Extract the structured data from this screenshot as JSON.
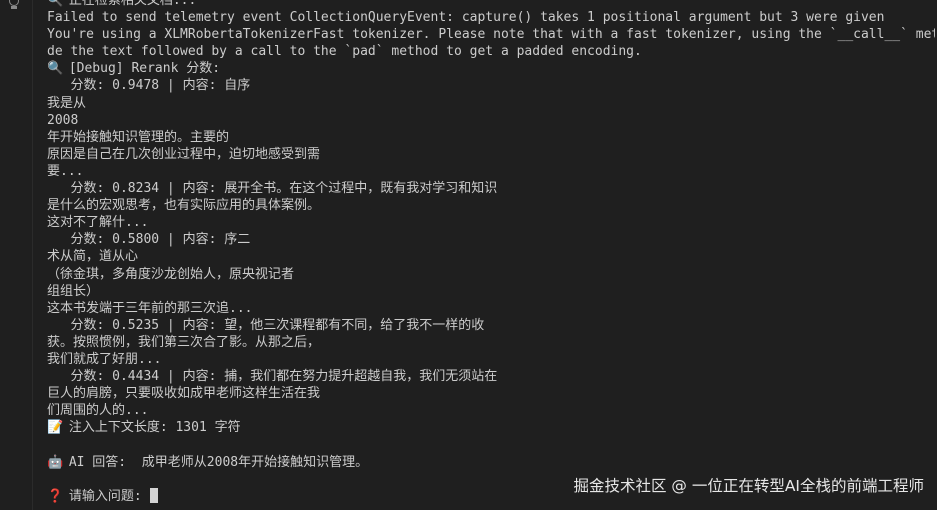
{
  "terminal": {
    "lines": [
      {
        "icon": "🔍",
        "text": "正在检索相关文档..."
      },
      {
        "icon": "",
        "text": "Failed to send telemetry event CollectionQueryEvent: capture() takes 1 positional argument but 3 were given"
      },
      {
        "icon": "",
        "text": "You're using a XLMRobertaTokenizerFast tokenizer. Please note that with a fast tokenizer, using the `__call__` method is faster"
      },
      {
        "icon": "",
        "text": "de the text followed by a call to the `pad` method to get a padded encoding."
      },
      {
        "icon": "🔍",
        "text": "[Debug] Rerank 分数:"
      },
      {
        "icon": "",
        "text": "   分数: 0.9478 | 内容: 自序"
      },
      {
        "icon": "",
        "text": "我是从"
      },
      {
        "icon": "",
        "text": "2008"
      },
      {
        "icon": "",
        "text": "年开始接触知识管理的。主要的"
      },
      {
        "icon": "",
        "text": "原因是自己在几次创业过程中，迫切地感受到需"
      },
      {
        "icon": "",
        "text": "要..."
      },
      {
        "icon": "",
        "text": "   分数: 0.8234 | 内容: 展开全书。在这个过程中，既有我对学习和知识"
      },
      {
        "icon": "",
        "text": "是什么的宏观思考，也有实际应用的具体案例。"
      },
      {
        "icon": "",
        "text": "这对不了解什..."
      },
      {
        "icon": "",
        "text": "   分数: 0.5800 | 内容: 序二"
      },
      {
        "icon": "",
        "text": "术从简，道从心"
      },
      {
        "icon": "",
        "text": "（徐金琪，多角度沙龙创始人，原央视记者"
      },
      {
        "icon": "",
        "text": "组组长）"
      },
      {
        "icon": "",
        "text": "这本书发端于三年前的那三次追..."
      },
      {
        "icon": "",
        "text": "   分数: 0.5235 | 内容: 望，他三次课程都有不同，给了我不一样的收"
      },
      {
        "icon": "",
        "text": "获。按照惯例，我们第三次合了影。从那之后，"
      },
      {
        "icon": "",
        "text": "我们就成了好朋..."
      },
      {
        "icon": "",
        "text": "   分数: 0.4434 | 内容: 捕，我们都在努力提升超越自我，我们无须站在"
      },
      {
        "icon": "",
        "text": "巨人的肩膀，只要吸收如成甲老师这样生活在我"
      },
      {
        "icon": "",
        "text": "们周围的人的..."
      },
      {
        "icon": "📝",
        "text": "注入上下文长度: 1301 字符"
      },
      {
        "icon": "",
        "text": ""
      },
      {
        "icon": "🤖",
        "text": "AI 回答:  成甲老师从2008年开始接触知识管理。"
      },
      {
        "icon": "",
        "text": ""
      }
    ],
    "prompt": {
      "icon": "❓",
      "text": "请输入问题: "
    }
  },
  "watermark": "掘金技术社区 @ 一位正在转型AI全栈的前端工程师",
  "icons": {
    "gutter": "lightbulb-icon"
  }
}
